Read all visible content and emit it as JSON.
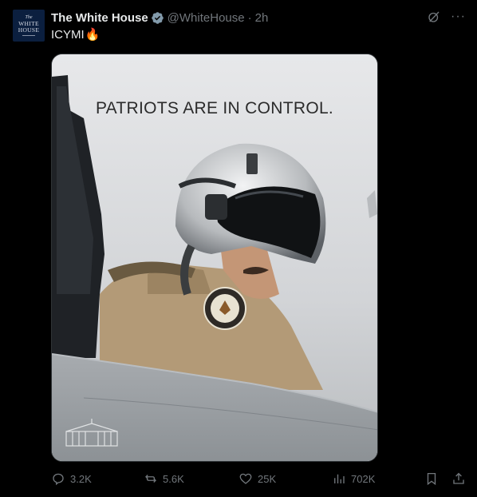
{
  "account": {
    "display_name": "The White House",
    "handle": "@WhiteHouse",
    "separator": "·",
    "time": "2h",
    "avatar_lines": [
      "The",
      "WHITE",
      "HOUSE"
    ],
    "verified_icon": "gray-verified-badge-icon"
  },
  "tweet": {
    "text": "ICYMI",
    "emoji": "🔥"
  },
  "media": {
    "headline": "PATRIOTS ARE IN CONTROL.",
    "watermark_icon": "white-house-logo-icon",
    "description_icon": "fighter-pilot-in-cockpit"
  },
  "top_actions": {
    "grok_icon": "grok-icon",
    "more_label": "···"
  },
  "metrics": {
    "replies": "3.2K",
    "reposts": "5.6K",
    "likes": "25K",
    "views": "702K"
  },
  "colors": {
    "background": "#000000",
    "text_primary": "#e7e9ea",
    "text_secondary": "#71767b",
    "avatar_bg": "#0b1f3f",
    "verified": "#829aab"
  }
}
